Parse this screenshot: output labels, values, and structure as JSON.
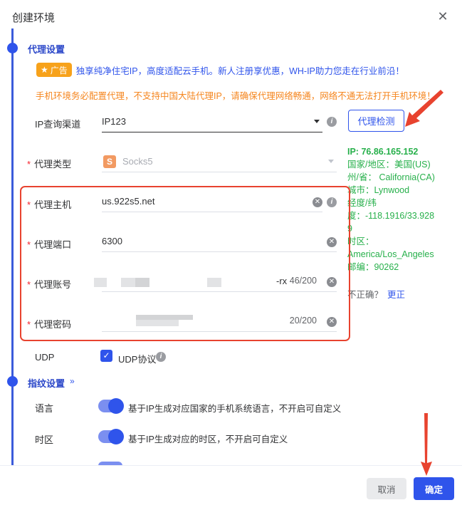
{
  "dialog": {
    "title": "创建环境"
  },
  "proxy_section": {
    "title": "代理设置",
    "ad": {
      "badge": "广告",
      "text": "独享纯净住宅IP，高度适配云手机。新人注册享优惠，WH-IP助力您走在行业前沿！"
    },
    "warning": "手机环境务必配置代理，不支持中国大陆代理IP，请确保代理网络畅通，网络不通无法打开手机环境！",
    "ip_channel": {
      "label": "IP查询渠道",
      "value": "IP123"
    },
    "check_button": "代理检测",
    "proxy_type": {
      "label": "代理类型",
      "value": "Socks5",
      "icon_letter": "S"
    },
    "host": {
      "label": "代理主机",
      "value": "us.922s5.net"
    },
    "port": {
      "label": "代理端口",
      "value": "6300"
    },
    "account": {
      "label": "代理账号",
      "visible_tail": "-rx",
      "count": "46/200"
    },
    "password": {
      "label": "代理密码",
      "count": "20/200"
    },
    "udp": {
      "label": "UDP",
      "checkbox_label": "UDP协议",
      "checked": true
    }
  },
  "ip_info": {
    "ip": "IP:  76.86.165.152",
    "country": "国家/地区：美国(US)",
    "state": "州/省：  California(CA)",
    "city": "城市：Lynwood",
    "lonlat_label": "经度/纬",
    "lonlat": "度：-118.1916/33.928",
    "lonlat_tail": "9",
    "tz_label": "时区：",
    "tz": "America/Los_Angeles",
    "zip": "邮编：90262",
    "incorrect": "不正确？",
    "update": "更正"
  },
  "fingerprint_section": {
    "title": "指纹设置",
    "language": {
      "label": "语言",
      "desc": "基于IP生成对应国家的手机系统语言，不开启可自定义"
    },
    "timezone": {
      "label": "时区",
      "desc": "基于IP生成对应的时区，不开启可自定义"
    }
  },
  "footer": {
    "cancel": "取消",
    "ok": "确定"
  },
  "colors": {
    "accent": "#2f54eb",
    "warning": "#f5861f",
    "success": "#27b04b",
    "highlight_box": "#e8432f"
  },
  "icons": [
    "close-icon",
    "star-icon",
    "chevron-down-icon",
    "info-icon",
    "clear-icon",
    "check-icon",
    "arrow-annotation-icon"
  ]
}
